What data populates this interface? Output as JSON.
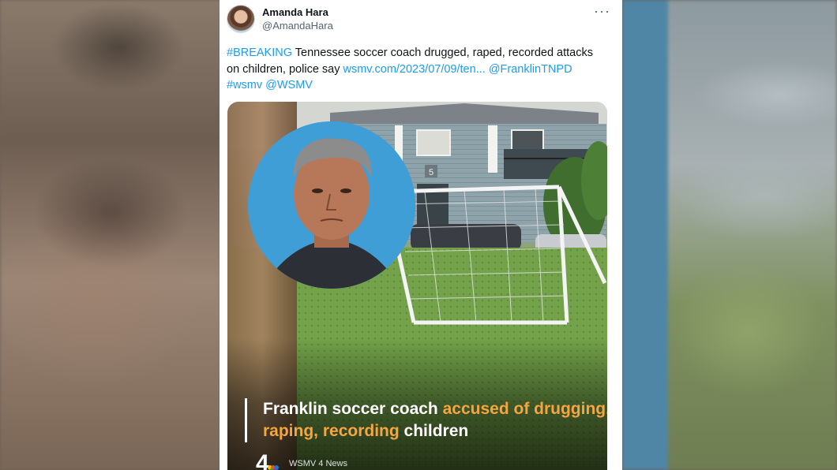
{
  "tweet": {
    "author_name": "Amanda Hara",
    "author_handle": "@AmandaHara",
    "more_icon": "more-icon",
    "text_parts": {
      "hashtag_breaking": "#BREAKING",
      "body": " Tennessee soccer coach drugged, raped, recorded attacks on children, police say ",
      "url": "wsmv.com/2023/07/09/ten...",
      "mention_franklin": "@FranklinTNPD",
      "hashtag_wsmv": "#wsmv",
      "mention_wsmv": "@WSMV"
    }
  },
  "media": {
    "headline_plain": "Franklin soccer coach ",
    "headline_highlight": "accused of drugging, raping, recording",
    "headline_end": " children",
    "building_number": "5",
    "brand_logo_text": "4",
    "brand_name": "WSMV 4 News"
  },
  "colors": {
    "link": "#1d9bf0",
    "highlight": "#f4a640"
  }
}
